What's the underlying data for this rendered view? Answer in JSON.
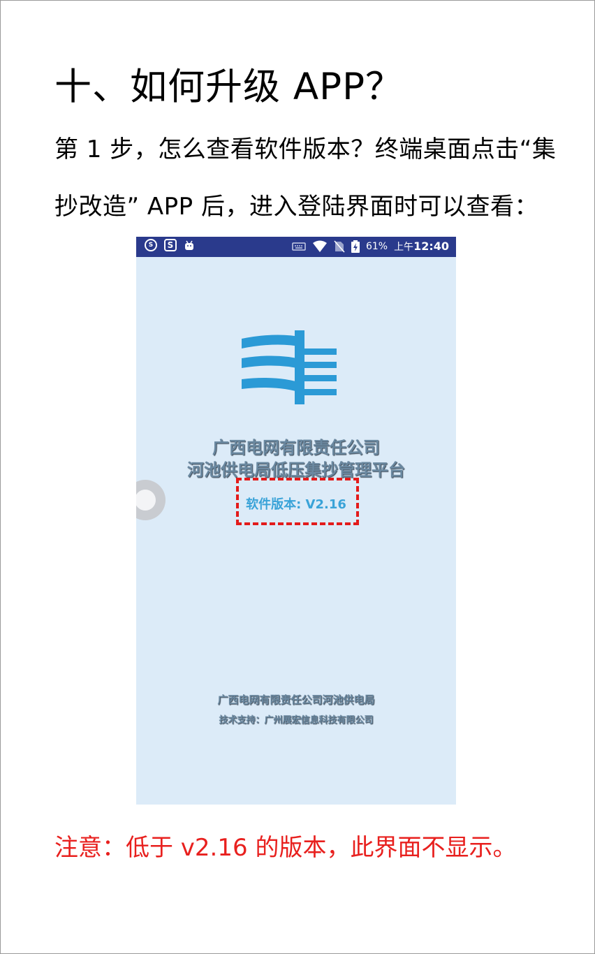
{
  "document": {
    "heading": "十、如何升级 APP？",
    "paragraph_line1": "第 1 步，怎么查看软件版本？终端桌面点击“集",
    "paragraph_line2": "抄改造” APP 后，进入登陆界面时可以查看：",
    "note": "注意：低于 v2.16 的版本，此界面不显示。"
  },
  "phone": {
    "statusbar": {
      "icons_left": [
        "sogou-icon",
        "s-app-icon",
        "android-icon"
      ],
      "icons_right": [
        "keyboard-icon",
        "wifi-icon",
        "no-sim-icon",
        "battery-icon"
      ],
      "battery": "61%",
      "time_prefix": "上午",
      "time": "12:40"
    },
    "company_line1": "广西电网有限责任公司",
    "company_line2": "河池供电局低压集抄管理平台",
    "version": "软件版本: V2.16",
    "footer_line1": "广西电网有限责任公司河池供电局",
    "footer_line2": "技术支持：广州展宏信息科技有限公司",
    "colors": {
      "statusbar": "#2a3a8c",
      "background": "#dcebf8",
      "logo": "#2b9ad6",
      "version_text": "#3aa3d8",
      "highlight_box": "#e31b1b"
    }
  }
}
